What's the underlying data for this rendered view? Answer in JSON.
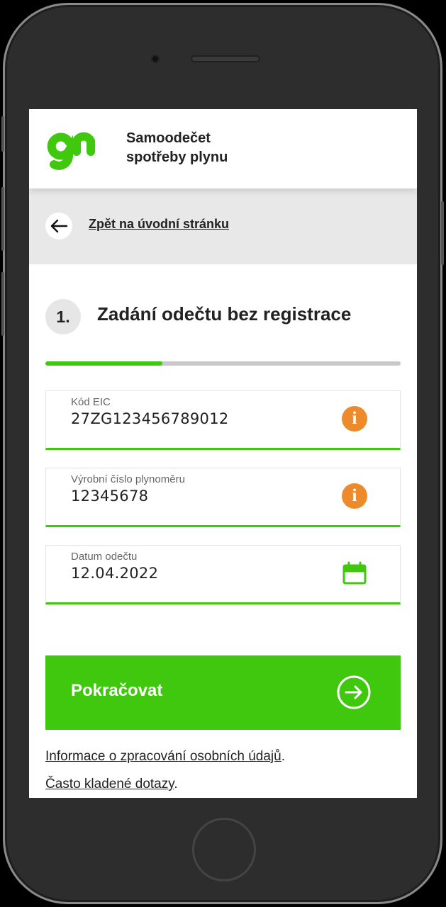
{
  "app": {
    "title_line1": "Samoodečet",
    "title_line2": "spotřeby plynu"
  },
  "back": {
    "label": "Zpět na úvodní stránku"
  },
  "step": {
    "number": "1.",
    "title": "Zadání odečtu bez registrace",
    "progress": 0.33
  },
  "fields": [
    {
      "label": "Kód EIC",
      "value": "27ZG123456789012",
      "icon": "info-icon"
    },
    {
      "label": "Výrobní číslo plynoměru",
      "value": "12345678",
      "icon": "info-icon"
    },
    {
      "label": "Datum odečtu",
      "value": "12.04.2022",
      "icon": "calendar-icon"
    }
  ],
  "cta": {
    "label": "Pokračovat",
    "icon": "arrow-right-circle-icon"
  },
  "footer": {
    "privacy_link": "Informace o zpracování osobních údajů",
    "privacy_suffix": ".",
    "faq_link": "Často kladené dotazy",
    "faq_suffix": "."
  },
  "colors": {
    "brand_green": "#40c80e",
    "info_orange": "#ec8a2c",
    "back_bar_gray": "#e8e8e8"
  }
}
